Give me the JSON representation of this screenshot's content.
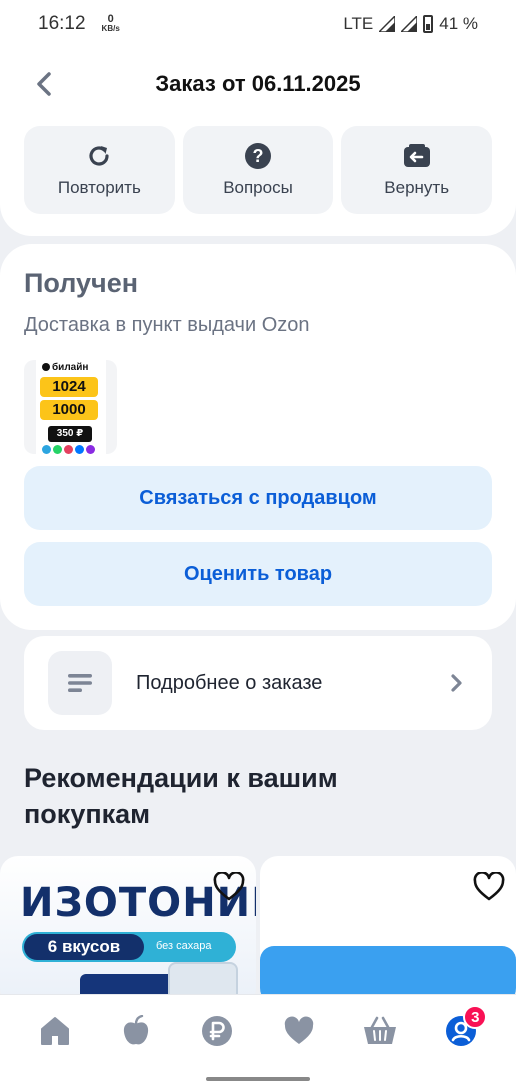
{
  "status_bar": {
    "time": "16:12",
    "speed_value": "0",
    "speed_unit": "KB/s",
    "network": "LTE",
    "battery": "41 %"
  },
  "header": {
    "title": "Заказ от 06.11.2025",
    "back_icon": "chevron-left-icon"
  },
  "actions": [
    {
      "label": "Повторить",
      "icon": "refresh-icon"
    },
    {
      "label": "Вопросы",
      "icon": "question-icon"
    },
    {
      "label": "Вернуть",
      "icon": "return-box-icon"
    }
  ],
  "order": {
    "status": "Получен",
    "delivery": "Доставка в пункт выдачи Ozon",
    "product": {
      "brand": "билайн",
      "data_gb": "1024",
      "minutes": "1000",
      "price": "350 ₽"
    },
    "contact_button": "Связаться с продавцом",
    "rate_button": "Оценить товар"
  },
  "details": {
    "label": "Подробнее о заказе"
  },
  "recommendations": {
    "title": "Рекомендации к вашим покупкам",
    "cards": [
      {
        "headline": "ИЗОТОНИК",
        "pill": "6 вкусов",
        "note": "без сахара"
      },
      {
        "headline": ""
      }
    ]
  },
  "bottom_nav": {
    "items": [
      "home-icon",
      "apple-icon",
      "ruble-icon",
      "heart-icon",
      "basket-icon",
      "profile-icon"
    ],
    "profile_badge": "3"
  },
  "colors": {
    "accent": "#0b5ed7",
    "button_bg": "#e4f1fc",
    "badge": "#f91155",
    "background": "#eef0f4"
  }
}
